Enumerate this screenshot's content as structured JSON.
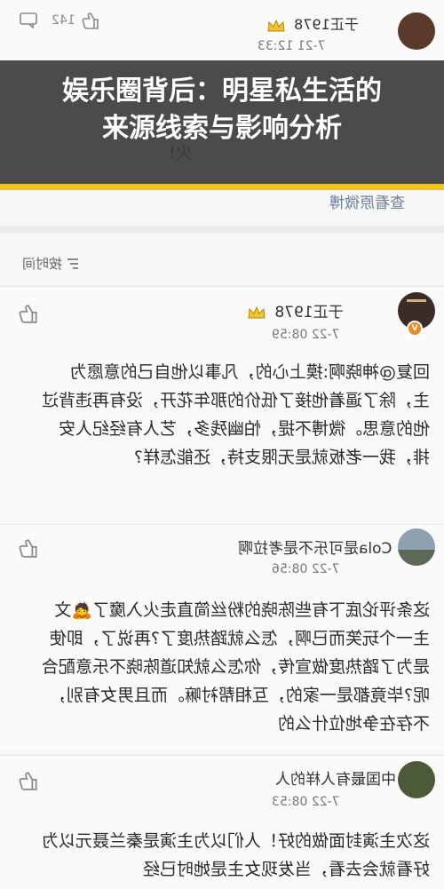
{
  "banner": {
    "line1": "娱乐圈背后：明星私生活的",
    "line2": "来源线索与影响分析",
    "accent": "#f0c419"
  },
  "top_remnant": {
    "like_count": "142",
    "user": "于正1978",
    "time": "7-21 12:33",
    "text_fragment": "火!",
    "view_weibo": "查看原微博"
  },
  "sort_label": "按时间",
  "comments": [
    {
      "user": "于正1978",
      "time": "7-22 08:59",
      "text": "回复@神晓啊:摸上心的，凡事以他自己的意愿为主，除了逼着他接了低价的那年花开，没有再违背过他的意思。微博不提，怕幽残多，艺人有经纪人安排，我一老板就是无限支持，还能怎样?"
    },
    {
      "user": "Cola是可乐不是考拉啊",
      "time": "7-22 08:56",
      "text": "这条评论底下有些陈晓的粉丝简直走火入魔了🙇文主一个玩笑而已啊，怎么就踏热度了?再说了，即使是为了踏热度做宣传，你怎么就知道陈晓不乐意配合呢?毕竟都是一家的，互相帮衬嘛。而且男女有别，不存在争地位什么的"
    },
    {
      "user": "中国最有人样的人",
      "time": "7-22 08:53",
      "text": "这次主演封面做的好！人们以为主演是秦兰聂元以为好看就会去看，当发现女主是她时已经"
    }
  ],
  "icons": [
    "thumbs-up-icon",
    "comment-icon",
    "crown-icon",
    "gold-badge-icon",
    "v-badge-icon",
    "sort-icon"
  ]
}
